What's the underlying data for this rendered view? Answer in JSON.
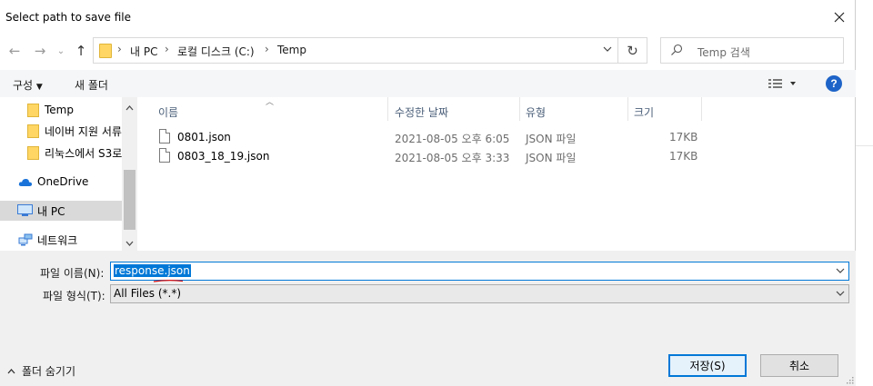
{
  "window": {
    "title": "Select path to save file"
  },
  "address": {
    "crumbs": [
      "내 PC",
      "로컬 디스크 (C:)",
      "Temp"
    ],
    "search_placeholder": "Temp 검색"
  },
  "toolbar": {
    "organize": "구성",
    "new_folder": "새 폴더"
  },
  "nav": {
    "items": [
      {
        "label": "Temp",
        "icon": "folder-icon"
      },
      {
        "label": "네이버 지원 서류",
        "icon": "folder-icon"
      },
      {
        "label": "리눅스에서 S3로",
        "icon": "folder-icon"
      },
      {
        "label": "OneDrive",
        "icon": "cloud-icon"
      },
      {
        "label": "내 PC",
        "icon": "computer-icon",
        "selected": true
      },
      {
        "label": "네트워크",
        "icon": "network-icon"
      }
    ]
  },
  "filelist": {
    "columns": [
      "이름",
      "수정한 날짜",
      "유형",
      "크기"
    ],
    "rows": [
      {
        "name": "0801.json",
        "modified": "2021-08-05 오후 6:05",
        "type": "JSON 파일",
        "size": "17KB"
      },
      {
        "name": "0803_18_19.json",
        "modified": "2021-08-05 오후 3:33",
        "type": "JSON 파일",
        "size": "17KB"
      }
    ]
  },
  "form": {
    "filename_label": "파일 이름(N):",
    "filename_value": "response.json",
    "filetype_label": "파일 형식(T):",
    "filetype_value": "All Files (*.*)",
    "hide_folders": "폴더 숨기기",
    "save_button": "저장(S)",
    "cancel_button": "취소"
  },
  "colors": {
    "accent": "#0078d7",
    "help": "#1e64c8",
    "folder": "#ffd663"
  }
}
